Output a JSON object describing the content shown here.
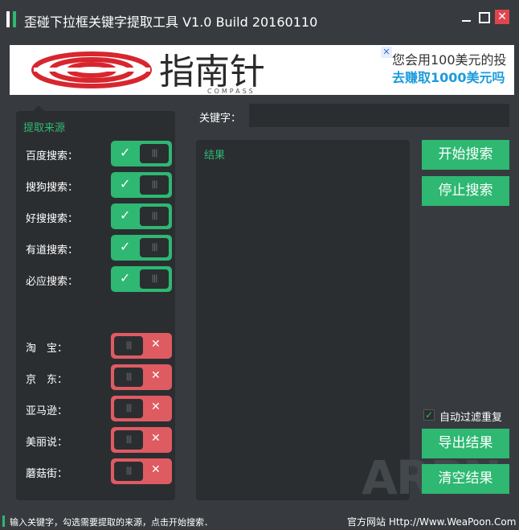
{
  "window": {
    "title": "歪碰下拉框关键字提取工具 V1.0 Build 20160110",
    "close_glyph": "✕"
  },
  "banner": {
    "logo_text": "指南针",
    "logo_sub": "COMPASS",
    "line1": "您会用100美元的投",
    "line2": "去赚取1000美元吗",
    "close_glyph": "✕"
  },
  "sources": {
    "title": "提取来源",
    "on_items": [
      {
        "label": "百度搜索：",
        "enabled": true
      },
      {
        "label": "搜狗搜索：",
        "enabled": true
      },
      {
        "label": "好搜搜索：",
        "enabled": true
      },
      {
        "label": "有道搜索：",
        "enabled": true
      },
      {
        "label": "必应搜索：",
        "enabled": true
      }
    ],
    "off_items": [
      {
        "label": "淘　宝：",
        "enabled": false
      },
      {
        "label": "京　东：",
        "enabled": false
      },
      {
        "label": "亚马逊：",
        "enabled": false
      },
      {
        "label": "美丽说：",
        "enabled": false
      },
      {
        "label": "蘑菇街：",
        "enabled": false
      }
    ],
    "on_glyph": "✓",
    "off_glyph": "✕",
    "knob_glyph": "|||"
  },
  "keyword": {
    "label": "关键字：",
    "value": ""
  },
  "results": {
    "title": "结果"
  },
  "buttons": {
    "start": "开始搜索",
    "stop": "停止搜索",
    "export": "导出结果",
    "clear": "清空结果"
  },
  "dedup": {
    "label": "自动过滤重复",
    "checked": true,
    "check_glyph": "✓"
  },
  "watermark": "ARPN",
  "status": {
    "message": "输入关键字，勾选需要提取的来源，点击开始搜索．",
    "site": "官方网站 Http://Www.WeaPoon.Com"
  },
  "colors": {
    "accent_green": "#2eb872",
    "toggle_off_red": "#df5b62",
    "background": "#373b3f",
    "panel": "#2b2e31",
    "banner_blue": "#1a9bdc",
    "logo_red": "#d8262e"
  }
}
